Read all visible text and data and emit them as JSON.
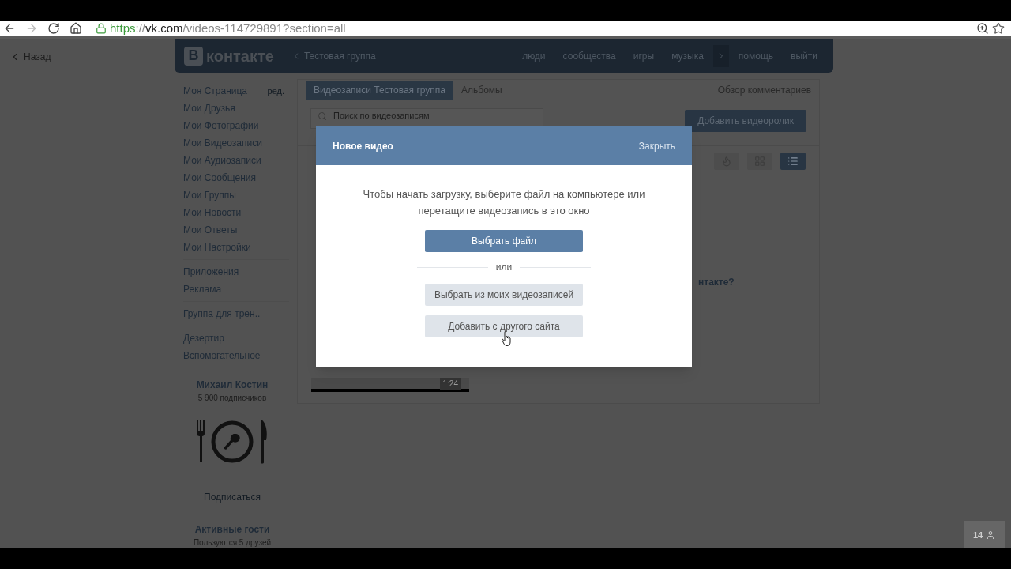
{
  "browser": {
    "url": [
      {
        "kind": "scheme",
        "text": "https"
      },
      {
        "kind": "dim",
        "text": "://"
      },
      {
        "kind": "host",
        "text": "vk.com"
      },
      {
        "kind": "dim",
        "text": "/videos-114729891?section=all"
      }
    ]
  },
  "back_link": "Назад",
  "header": {
    "logo_letter": "В",
    "logo_text": "контакте",
    "group": "Тестовая группа",
    "nav": [
      {
        "kind": "link",
        "label": "люди"
      },
      {
        "kind": "link",
        "label": "сообщества"
      },
      {
        "kind": "link",
        "label": "игры"
      },
      {
        "kind": "link",
        "label": "музыка"
      },
      {
        "kind": "more"
      },
      {
        "kind": "link",
        "label": "помощь"
      },
      {
        "kind": "link",
        "label": "выйти"
      }
    ]
  },
  "sidebar": {
    "edit_label": "ред.",
    "groups": [
      [
        "Моя Страница",
        "Мои Друзья",
        "Мои Фотографии",
        "Мои Видеозаписи",
        "Мои Аудиозаписи",
        "Мои Сообщения",
        "Мои Группы",
        "Мои Новости",
        "Мои Ответы",
        "Мои Настройки"
      ],
      [
        "Приложения",
        "Реклама"
      ],
      [
        "Группа для трен.."
      ],
      [
        "Дезертир",
        "Вспомогательное"
      ]
    ]
  },
  "profile": {
    "name": "Михаил Костин",
    "subscribers": "5 900 подписчиков",
    "subscribe": "Подписаться",
    "guests_title": "Активные гости",
    "guests_sub": "Пользуются 5 друзей"
  },
  "tabs": [
    {
      "label": "Видеозаписи Тестовая группа",
      "selected": true
    },
    {
      "label": "Альбомы",
      "selected": false
    }
  ],
  "comments_link": "Обзор комментариев",
  "search": {
    "placeholder": "Поиск по видеозаписям"
  },
  "add_button": "Добавить видеоролик",
  "view_buttons": [
    {
      "kind": "fire",
      "selected": false
    },
    {
      "kind": "grid",
      "selected": false
    },
    {
      "kind": "list",
      "selected": true
    }
  ],
  "video": {
    "duration": "1:24",
    "title_fragment": "нтакте?"
  },
  "modal": {
    "title": "Новое видео",
    "close": "Закрыть",
    "message": "Чтобы начать загрузку, выберите файл на компьютере или перетащите видеозапись в это окно",
    "primary": "Выбрать файл",
    "separator": "или",
    "secondary": [
      "Выбрать из моих видеозаписей",
      "Добавить с другого сайта"
    ]
  },
  "online_count": "14"
}
